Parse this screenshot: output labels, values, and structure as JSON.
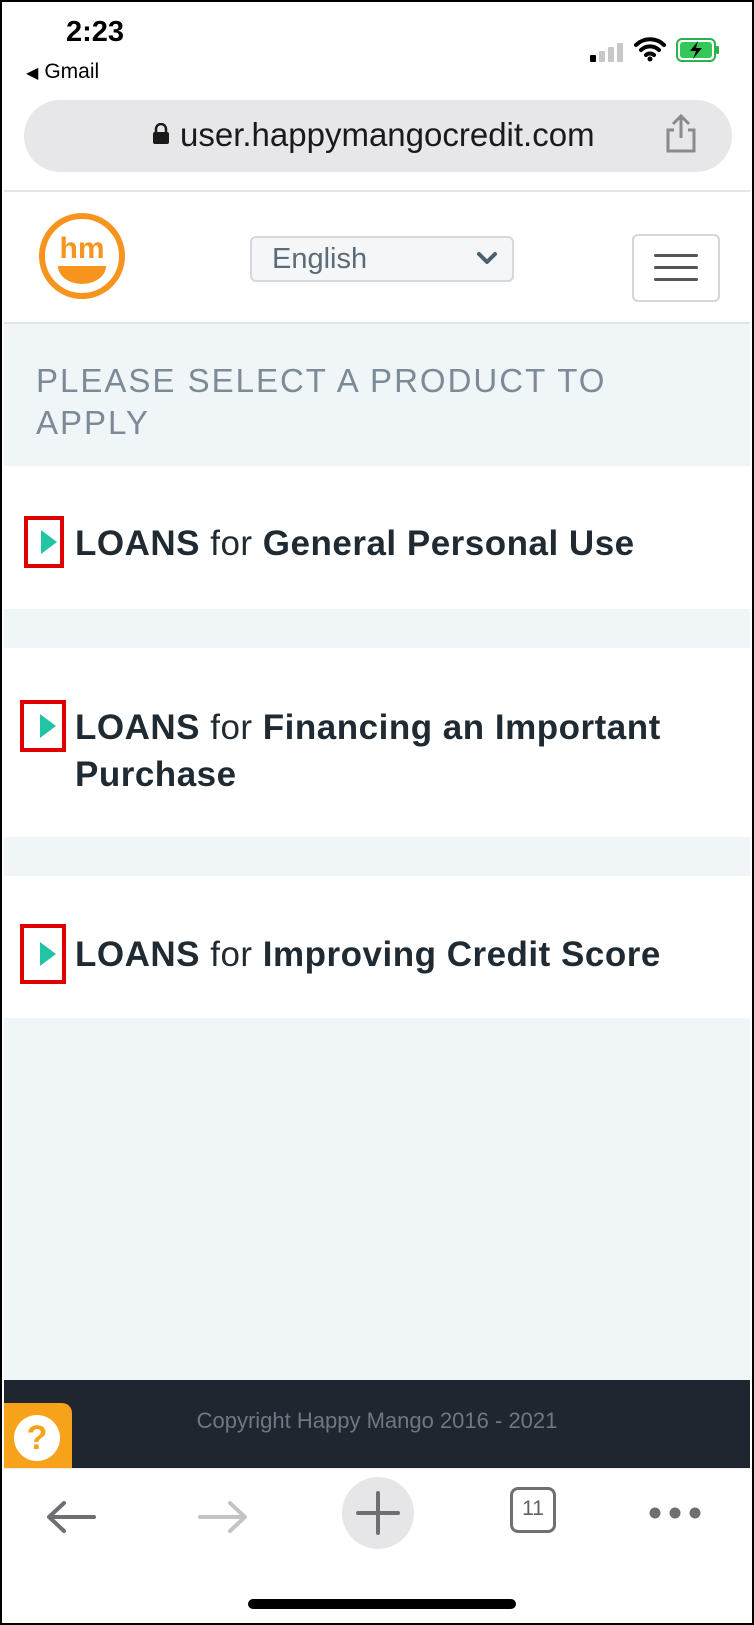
{
  "status_bar": {
    "time": "2:23",
    "back_app": "Gmail",
    "back_glyph": "◀"
  },
  "browser": {
    "url": "user.happymangocredit.com",
    "tab_count": "11"
  },
  "header": {
    "logo_text": "hm",
    "language": "English"
  },
  "main": {
    "prompt": "PLEASE SELECT A PRODUCT TO APPLY",
    "products": [
      {
        "prefix": "LOANS",
        "connector": " for ",
        "title": "General Personal Use"
      },
      {
        "prefix": "LOANS",
        "connector": " for ",
        "title": "Financing an Important Purchase"
      },
      {
        "prefix": "LOANS",
        "connector": " for ",
        "title": "Improving Credit Score"
      }
    ]
  },
  "footer": {
    "copyright": "Copyright Happy Mango 2016 - 2021",
    "help_glyph": "?"
  },
  "colors": {
    "brand_orange": "#f7941d",
    "accent_teal": "#22c4a4",
    "highlight_red": "#e00000",
    "footer_bg": "#1f262f"
  }
}
